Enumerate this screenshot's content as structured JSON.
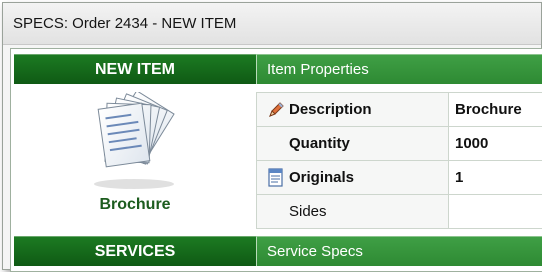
{
  "window": {
    "title": "SPECS: Order 2434 - NEW ITEM"
  },
  "left_panel": {
    "header": "NEW ITEM",
    "item_icon": "brochure-stack-icon",
    "item_name": "Brochure"
  },
  "item_properties": {
    "header": "Item Properties",
    "rows": [
      {
        "label": "Description",
        "value": "Brochure",
        "icon": "pencil-icon"
      },
      {
        "label": "Quantity",
        "value": "1000"
      },
      {
        "label": "Originals",
        "value": "1",
        "icon": "originals-doc-icon"
      },
      {
        "label": "Sides",
        "value": ""
      }
    ]
  },
  "services": {
    "header": "SERVICES",
    "specs_header": "Service Specs"
  },
  "colors": {
    "header_dark": "#16691b",
    "header_light": "#3a9a40",
    "item_name": "#1c5c1e"
  }
}
